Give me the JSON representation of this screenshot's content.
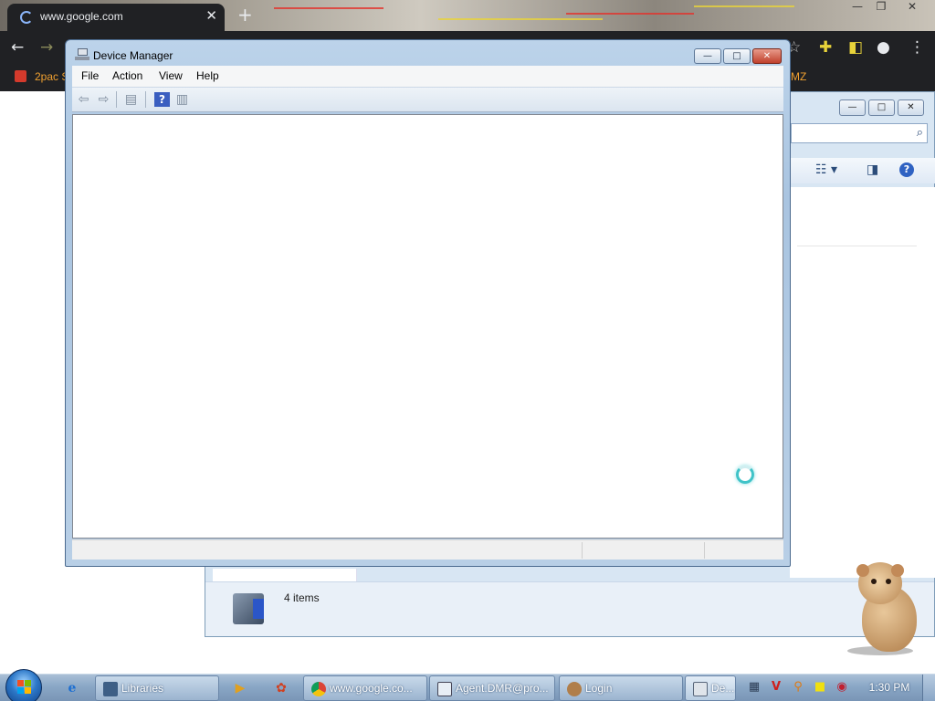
{
  "chrome": {
    "tab_title": "www.google.com",
    "tab_close": "✕",
    "new_tab": "+",
    "bookmark_left": "2pac S",
    "bookmark_right": "MZ",
    "win_minimize": "—",
    "win_restore": "❐",
    "win_close": "✕"
  },
  "libraries": {
    "search_icon": "search-icon",
    "status_text": "4 items"
  },
  "device_manager": {
    "title": "Device Manager",
    "menu": [
      "File",
      "Action",
      "View",
      "Help"
    ],
    "caption_buttons": {
      "minimize": "—",
      "maximize": "□",
      "close": "✕"
    },
    "toolbar_icons": [
      "back-arrow-icon",
      "forward-arrow-icon",
      "show-hide-console-tree-icon",
      "help-icon",
      "properties-icon"
    ],
    "busy_indicator": "busy-spinner-icon"
  },
  "taskbar": {
    "buttons": [
      {
        "label": "Libraries",
        "icon": "folder-icon"
      },
      {
        "label": "www.google.co...",
        "icon": "chrome-icon"
      },
      {
        "label": "Agent.DMR@pro...",
        "icon": "agent-icon"
      },
      {
        "label": "Login",
        "icon": "login-icon"
      },
      {
        "label": "De...",
        "icon": "device-manager-icon"
      }
    ],
    "quick_launch": [
      "internet-explorer-icon",
      "media-player-icon",
      "paint-icon"
    ],
    "tray_icons": [
      "network-icon",
      "antivirus-v-icon",
      "search-o-icon",
      "message-icon",
      "record-icon"
    ],
    "clock": "1:30 PM"
  },
  "colors": {
    "chrome_dark": "#202124",
    "bookmark_orange": "#f0a030",
    "aero_blue": "#a9c4e0",
    "close_red": "#c0402c",
    "busy_cyan": "#3fc3c8"
  }
}
